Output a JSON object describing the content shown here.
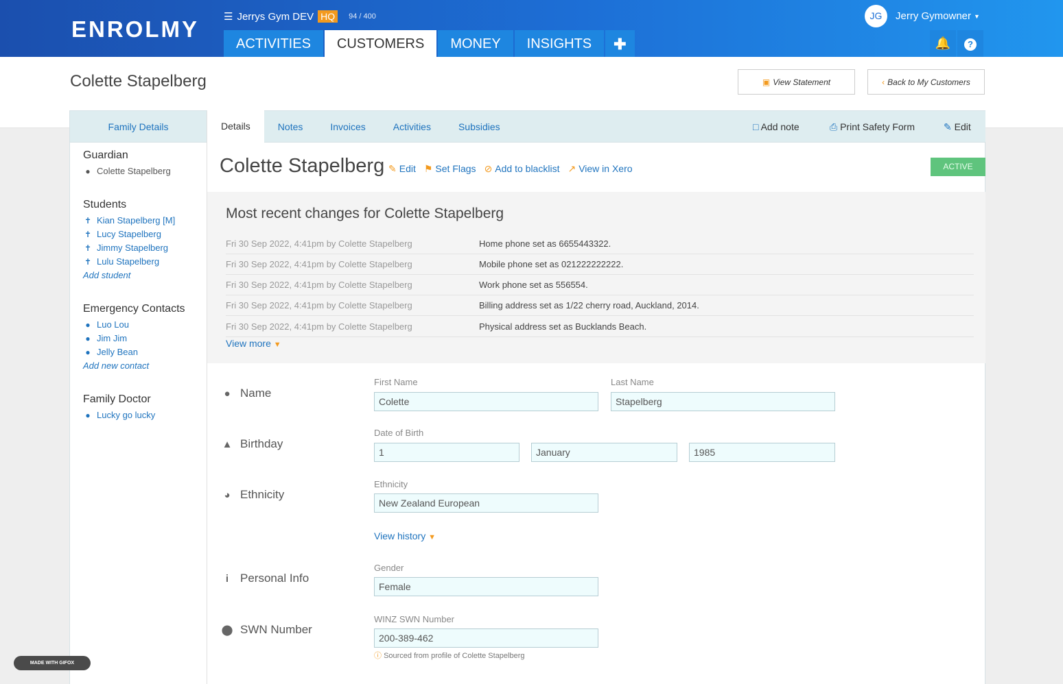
{
  "header": {
    "logo": "ENROLMY",
    "menu_icon": "menu-icon",
    "gym_name": "Jerrys Gym DEV",
    "hq_badge": "HQ",
    "count": "94 / 400",
    "nav_tabs": [
      "ACTIVITIES",
      "CUSTOMERS",
      "MONEY",
      "INSIGHTS"
    ],
    "active_tab": "CUSTOMERS",
    "user_initials": "JG",
    "user_name": "Jerry Gymowner",
    "colors": {
      "brand_blue": "#1d6fd6",
      "accent_orange": "#f39a1e",
      "active_green": "#5fc47d"
    }
  },
  "page": {
    "title": "Colette Stapelberg",
    "view_statement": "View Statement",
    "back": "Back to My Customers"
  },
  "sidebar": {
    "tab": "Family Details",
    "guardian_heading": "Guardian",
    "guardian": "Colette Stapelberg",
    "students_heading": "Students",
    "students": [
      "Kian Stapelberg [M]",
      "Lucy Stapelberg",
      "Jimmy Stapelberg",
      "Lulu Stapelberg"
    ],
    "add_student": "Add student",
    "emergency_heading": "Emergency Contacts",
    "contacts": [
      "Luo Lou",
      "Jim Jim",
      "Jelly Bean"
    ],
    "add_contact": "Add new contact",
    "doctor_heading": "Family Doctor",
    "doctor": "Lucky go lucky"
  },
  "tabs": {
    "items": [
      "Details",
      "Notes",
      "Invoices",
      "Activities",
      "Subsidies"
    ],
    "active": "Details",
    "add_note": "Add note",
    "print_safety": "Print Safety Form",
    "edit": "Edit"
  },
  "customer": {
    "name": "Colette Stapelberg",
    "edit": "Edit",
    "set_flags": "Set Flags",
    "blacklist": "Add to blacklist",
    "xero": "View in Xero",
    "status": "ACTIVE"
  },
  "changes": {
    "heading": "Most recent changes for Colette Stapelberg",
    "rows": [
      {
        "when": "Fri 30 Sep 2022, 4:41pm by Colette Stapelberg",
        "desc": "Home phone set as 6655443322."
      },
      {
        "when": "Fri 30 Sep 2022, 4:41pm by Colette Stapelberg",
        "desc": "Mobile phone set as 021222222222."
      },
      {
        "when": "Fri 30 Sep 2022, 4:41pm by Colette Stapelberg",
        "desc": "Work phone set as 556554."
      },
      {
        "when": "Fri 30 Sep 2022, 4:41pm by Colette Stapelberg",
        "desc": "Billing address set as 1/22 cherry road, Auckland, 2014."
      },
      {
        "when": "Fri 30 Sep 2022, 4:41pm by Colette Stapelberg",
        "desc": "Physical address set as Bucklands Beach."
      }
    ],
    "view_more": "View more"
  },
  "form": {
    "name_label": "Name",
    "first_name_label": "First Name",
    "first_name": "Colette",
    "last_name_label": "Last Name",
    "last_name": "Stapelberg",
    "birthday_label": "Birthday",
    "dob_label": "Date of Birth",
    "dob_day": "1",
    "dob_month": "January",
    "dob_year": "1985",
    "ethnicity_label": "Ethnicity",
    "ethnicity_sublabel": "Ethnicity",
    "ethnicity": "New Zealand European",
    "view_history": "View history",
    "personal_label": "Personal Info",
    "gender_label": "Gender",
    "gender": "Female",
    "swn_label": "SWN Number",
    "winz_label": "WINZ SWN Number",
    "swn": "200-389-462",
    "sourced": "Sourced from profile of Colette Stapelberg"
  },
  "badge": {
    "gifox": "MADE WITH GIFOX"
  }
}
